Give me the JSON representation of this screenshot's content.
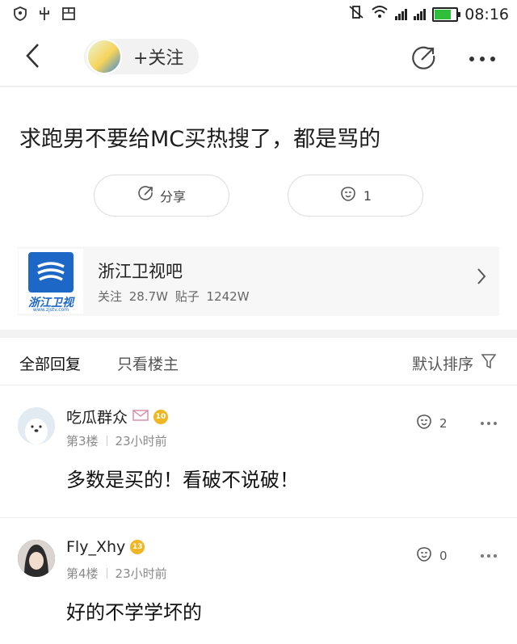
{
  "status_bar": {
    "time": "08:16"
  },
  "nav": {
    "follow_label": "+关注"
  },
  "post": {
    "title": "求跑男不要给MC买热搜了，都是骂的"
  },
  "actions": {
    "share_label": "分享",
    "like_count": "1"
  },
  "forum": {
    "name": "浙江卫视吧",
    "stats": "关注 28.7W  贴子 1242W",
    "logo_text": "浙江卫视",
    "logo_url": "www.zjstv.com"
  },
  "tabs": [
    {
      "label": "全部回复",
      "active": true
    },
    {
      "label": "只看楼主",
      "active": false
    }
  ],
  "sort_label": "默认排序",
  "comments": [
    {
      "username": "吃瓜群众",
      "level": "10",
      "floor": "第3楼",
      "time": "23小时前",
      "likes": "2",
      "text": "多数是买的！看破不说破！"
    },
    {
      "username": "Fly_Xhy",
      "level": "13",
      "floor": "第4楼",
      "time": "23小时前",
      "likes": "0",
      "text": "好的不学学坏的"
    }
  ],
  "colors": {
    "level_badge": "#f0b623",
    "forum_blue": "#1d68c6",
    "battery_green": "#2fbf3a"
  }
}
